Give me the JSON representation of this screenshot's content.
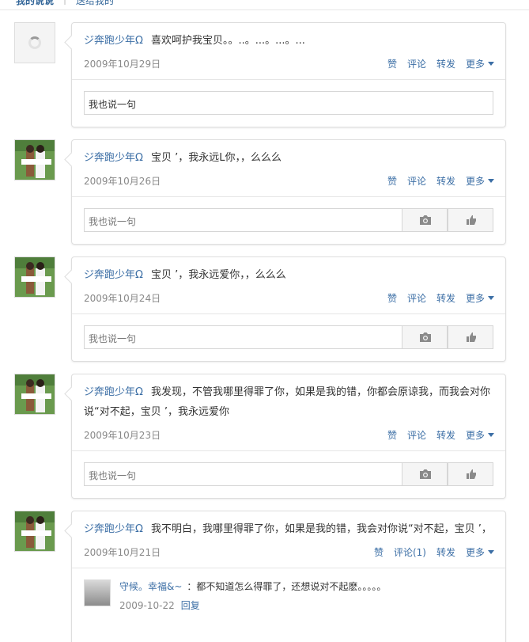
{
  "topbar": {
    "tab1": "我的说说",
    "tab2": "送给我的"
  },
  "actions": {
    "like": "赞",
    "comment": "评论",
    "forward": "转发",
    "more": "更多"
  },
  "reply_placeholder": "我也说一句",
  "posts": [
    {
      "author": "ジ奔跑少年Ω",
      "text": "喜欢呵护我宝贝。。..。...。...。...",
      "date": "2009年10月29日",
      "comment_label": "评论"
    },
    {
      "author": "ジ奔跑少年Ω",
      "text": "宝贝 ’，我永远L你，，么么么",
      "date": "2009年10月26日",
      "comment_label": "评论"
    },
    {
      "author": "ジ奔跑少年Ω",
      "text": "宝贝 ’，我永远爱你，，么么么",
      "date": "2009年10月24日",
      "comment_label": "评论"
    },
    {
      "author": "ジ奔跑少年Ω",
      "text": "我发现，不管我哪里得罪了你，如果是我的错，你都会原谅我，而我会对你说“对不起，宝贝 ’，我永远爱你",
      "date": "2009年10月23日",
      "comment_label": "评论"
    },
    {
      "author": "ジ奔跑少年Ω",
      "text": "我不明白，我哪里得罪了你，如果是我的错，我会对你说“对不起，宝贝 ’，",
      "date": "2009年10月21日",
      "comment_label": "评论(1)"
    }
  ],
  "comment": {
    "author": "守候。幸福&~",
    "text": "：都不知道怎么得罪了，还想说对不起麽。。。。。",
    "date": "2009-10-22",
    "reply": "回复"
  }
}
